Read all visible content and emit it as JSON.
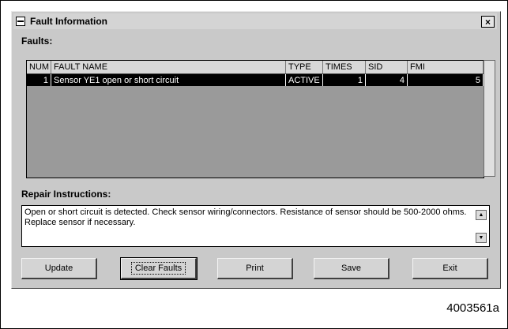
{
  "window": {
    "title": "Fault Information",
    "close_glyph": "×"
  },
  "faults": {
    "label": "Faults:",
    "columns": [
      "NUM",
      "FAULT NAME",
      "TYPE",
      "TIMES",
      "SID",
      "FMI"
    ],
    "rows": [
      {
        "num": "1",
        "fault_name": "Sensor YE1 open or short circuit",
        "type": "ACTIVE",
        "times": "1",
        "sid": "4",
        "fmi": "5"
      }
    ]
  },
  "repair": {
    "label": "Repair Instructions:",
    "text": "Open or short circuit is detected. Check sensor wiring/connectors. Resistance of sensor should be 500-2000 ohms. Replace sensor if necessary.",
    "scroll_up_glyph": "▲",
    "scroll_down_glyph": "▼"
  },
  "buttons": {
    "update": "Update",
    "clear_faults": "Clear Faults",
    "print": "Print",
    "save": "Save",
    "exit": "Exit"
  },
  "figure_id": "4003561a",
  "icons": {
    "system_menu": "window-menu-icon",
    "close": "close-icon"
  }
}
